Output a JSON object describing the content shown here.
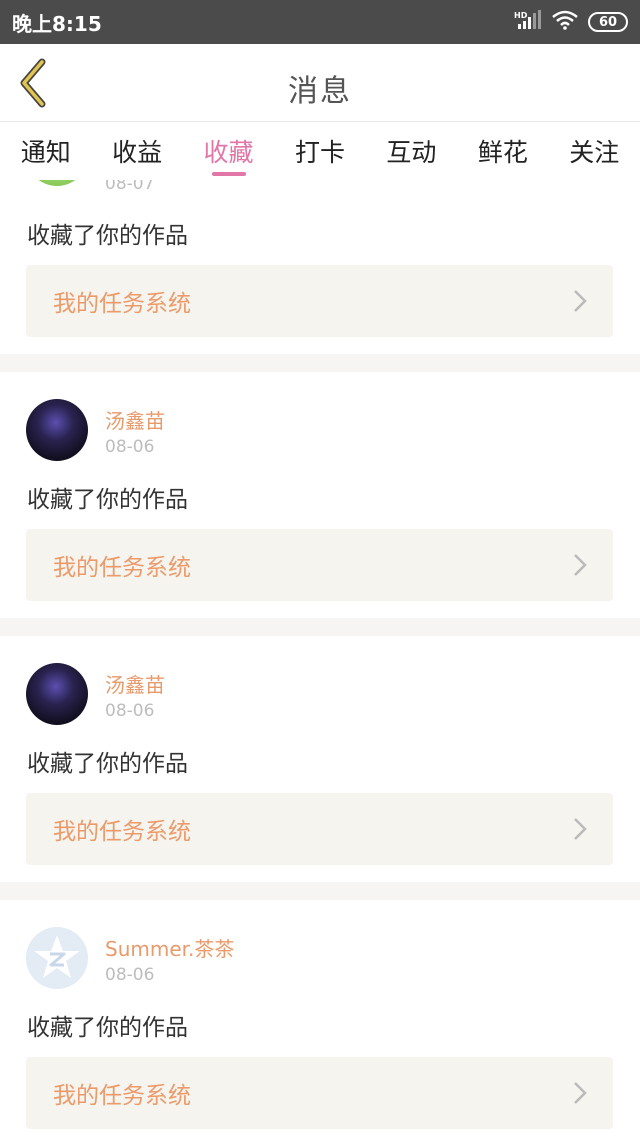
{
  "status_bar": {
    "time": "晚上8:15",
    "battery": "60",
    "network": "HD"
  },
  "header": {
    "title": "消息"
  },
  "tabs": [
    {
      "label": "通知"
    },
    {
      "label": "收益"
    },
    {
      "label": "收藏",
      "active": true
    },
    {
      "label": "打卡"
    },
    {
      "label": "互动"
    },
    {
      "label": "鲜花"
    },
    {
      "label": "关注"
    }
  ],
  "items": [
    {
      "user": "",
      "date": "08-07",
      "message": "收藏了你的作品",
      "link": "我的任务系统"
    },
    {
      "user": "汤鑫苗",
      "date": "08-06",
      "message": "收藏了你的作品",
      "link": "我的任务系统"
    },
    {
      "user": "汤鑫苗",
      "date": "08-06",
      "message": "收藏了你的作品",
      "link": "我的任务系统"
    },
    {
      "user": "Summer.茶茶",
      "date": "08-06",
      "message": "收藏了你的作品",
      "link": "我的任务系统"
    }
  ],
  "colors": {
    "accent": "#e376a8",
    "username": "#e89a6b",
    "link": "#ec9a6a"
  }
}
